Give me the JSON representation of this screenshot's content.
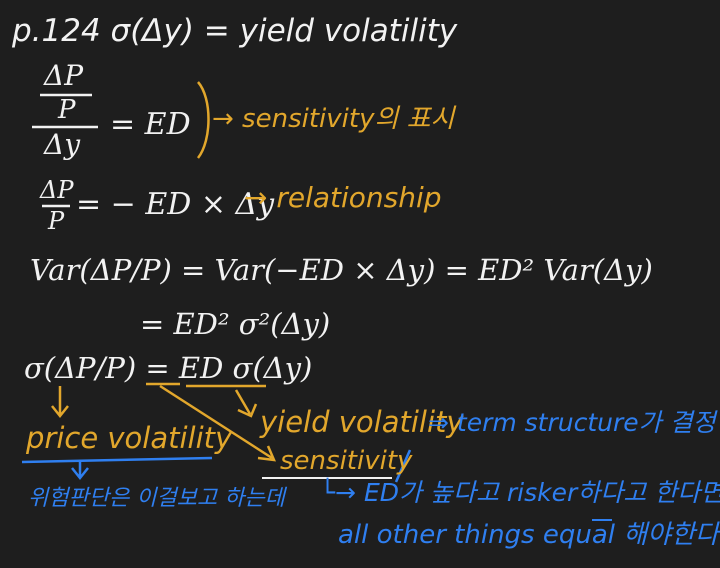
{
  "page": {
    "heading": "p.124  σ(Δy) = yield volatility"
  },
  "lines": {
    "frac_num_top": "ΔP",
    "frac_den_top": "P",
    "frac_den_bottom": "Δy",
    "ed_eq": "= ED",
    "sensitivity_note": "→ sensitivity의 표시",
    "relation_lhs_top": "ΔP",
    "relation_lhs_bottom": "P",
    "relation_rhs": "= − ED × Δy",
    "relation_note": "→ relationship",
    "var_line": "Var(ΔP/P) = Var(−ED × Δy) = ED² Var(Δy)",
    "var_line2": "= ED² σ²(Δy)",
    "sigma_line": "σ(ΔP/P) = ED σ(Δy)"
  },
  "annotations": {
    "price_volatility": "price volatility",
    "yield_volatility": "yield volatility",
    "term_structure": "⇒ term structure가 결정",
    "sensitivity": "sensitivity",
    "risk_note": "위험판단은 이걸보고 하는데",
    "ed_note": "└→ ED가 높다고 risker하다고 한다면",
    "other_things": "all other things  equal 해야한다"
  },
  "colors": {
    "background": "#1e1e1e",
    "white_ink": "#f2f2f2",
    "orange_ink": "#e2a72c",
    "blue_ink": "#2f7ff0"
  }
}
